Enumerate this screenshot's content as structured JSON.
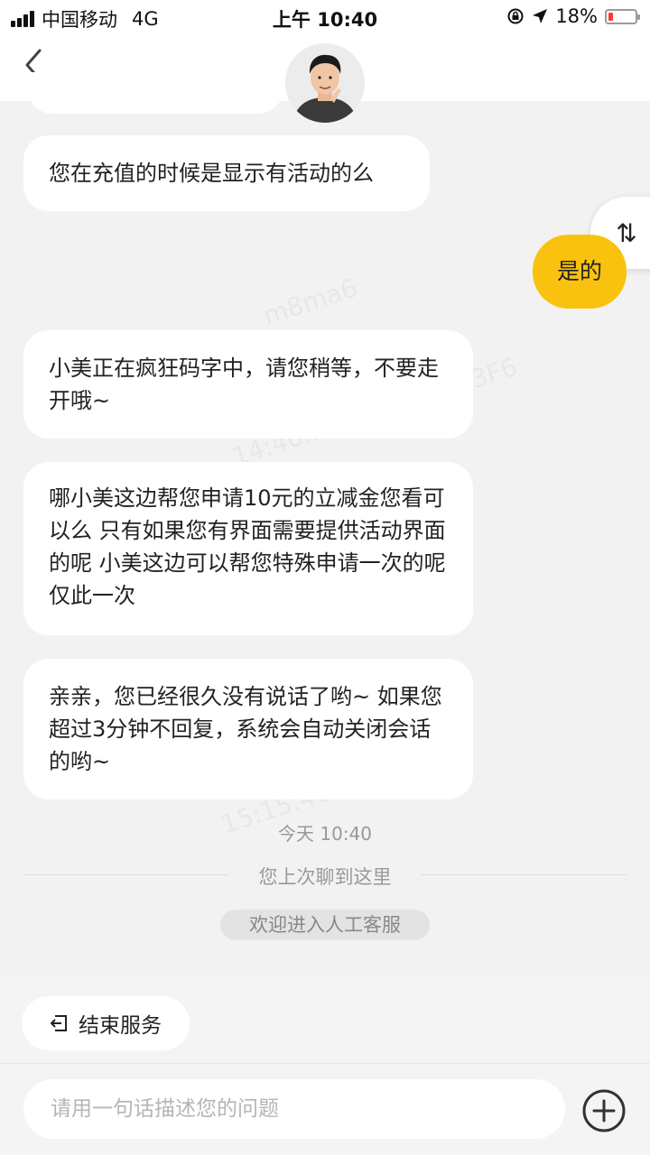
{
  "status_bar": {
    "carrier": "中国移动",
    "network": "4G",
    "time": "上午 10:40",
    "battery_text": "18%",
    "battery_level": 0.18
  },
  "header": {
    "back_icon": "chevron-left-icon",
    "avatar_icon": "agent-avatar"
  },
  "messages": [
    {
      "side": "in",
      "text": "您在充值的时候是显示有活动的么"
    },
    {
      "side": "out",
      "text": "是的"
    },
    {
      "side": "in",
      "text": "小美正在疯狂码字中，请您稍等，不要走开哦~"
    },
    {
      "side": "in",
      "text": "哪小美这边帮您申请10元的立减金您看可以么  只有如果您有界面需要提供活动界面的呢   小美这边可以帮您特殊申请一次的呢 仅此一次"
    },
    {
      "side": "in",
      "text": "亲亲，您已经很久没有说话了哟~ 如果您超过3分钟不回复，系统会自动关闭会话的哟~"
    }
  ],
  "swap_icon": "swap-vertical-icon",
  "timestamp": "今天 10:40",
  "last_chat_marker": "您上次聊到这里",
  "system_notice": "欢迎进入人工客服",
  "actions": {
    "end_service": "结束服务",
    "end_service_icon": "exit-icon"
  },
  "input": {
    "placeholder": "请用一句话描述您的问题",
    "plus_icon": "plus-circle-icon"
  },
  "colors": {
    "accent": "#f9c20e",
    "background": "#f2f2f2",
    "battery_low": "#ff3b30"
  }
}
